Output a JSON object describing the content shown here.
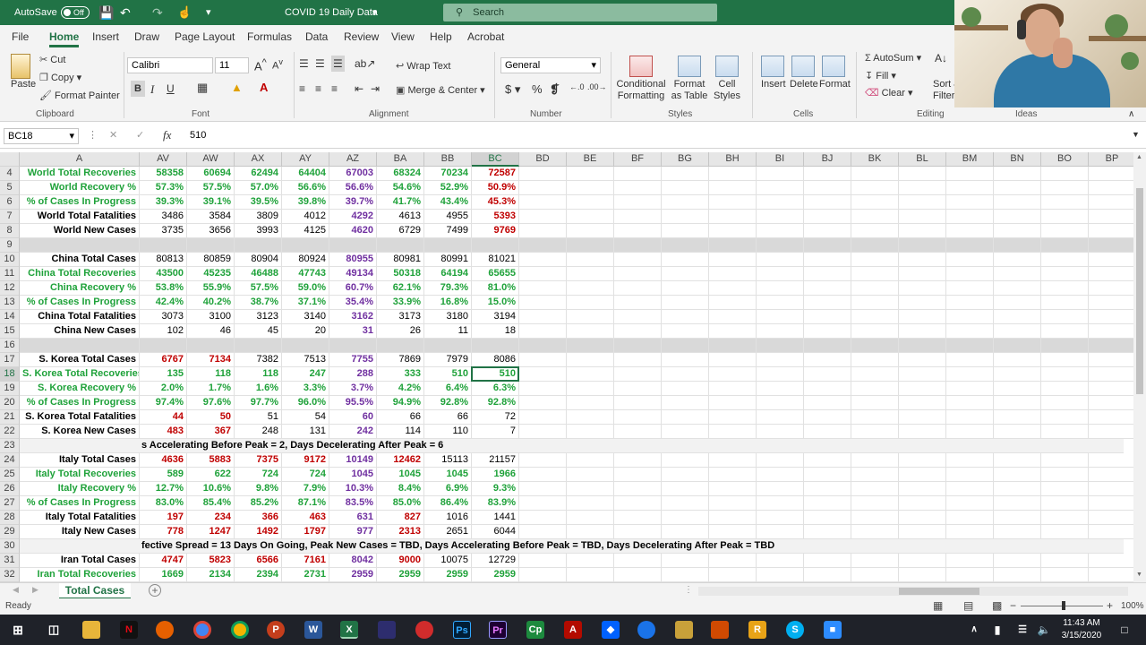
{
  "titlebar": {
    "autosave_label": "AutoSave",
    "autosave_state": "Off",
    "doc_title": "COVID 19 Daily Data",
    "search_placeholder": "Search"
  },
  "menu": {
    "tabs": [
      "File",
      "Home",
      "Insert",
      "Draw",
      "Page Layout",
      "Formulas",
      "Data",
      "Review",
      "View",
      "Help",
      "Acrobat"
    ]
  },
  "ribbon": {
    "clipboard": {
      "paste": "Paste",
      "cut": "Cut",
      "copy": "Copy",
      "format_painter": "Format Painter",
      "label": "Clipboard"
    },
    "font": {
      "name": "Calibri",
      "size": "11",
      "label": "Font"
    },
    "alignment": {
      "wrap": "Wrap Text",
      "merge": "Merge & Center",
      "label": "Alignment"
    },
    "number": {
      "format": "General",
      "label": "Number"
    },
    "styles": {
      "conditional": "Conditional Formatting",
      "format_table": "Format as Table",
      "cell_styles": "Cell Styles",
      "label": "Styles"
    },
    "cells": {
      "insert": "Insert",
      "delete": "Delete",
      "format": "Format",
      "label": "Cells"
    },
    "editing": {
      "autosum": "AutoSum",
      "fill": "Fill",
      "clear": "Clear",
      "sort": "Sort &",
      "filter": "Filter",
      "label": "Editing"
    },
    "ideas": {
      "label": "Ideas"
    }
  },
  "formula_bar": {
    "name_box": "BC18",
    "content": "510"
  },
  "colors": {
    "green": "#1fa23a",
    "purple": "#7030a0",
    "red": "#c00000",
    "dark": "#000000",
    "accent": "#217346"
  },
  "columns": [
    "A",
    "AV",
    "AW",
    "AX",
    "AY",
    "AZ",
    "BA",
    "BB",
    "BC",
    "BD",
    "BE",
    "BF",
    "BG",
    "BH",
    "BI",
    "BJ",
    "BK",
    "BL",
    "BM",
    "BN",
    "BO",
    "BP"
  ],
  "rows": [
    {
      "n": "4",
      "label": "World Total Recoveries",
      "lc": "green",
      "vals": [
        "58358",
        "60694",
        "62494",
        "64404",
        "67003",
        "68324",
        "70234",
        "72587"
      ],
      "vc": [
        "green",
        "green",
        "green",
        "green",
        "purple",
        "green",
        "green",
        "red"
      ]
    },
    {
      "n": "5",
      "label": "World Recovery %",
      "lc": "green",
      "vals": [
        "57.3%",
        "57.5%",
        "57.0%",
        "56.6%",
        "56.6%",
        "54.6%",
        "52.9%",
        "50.9%"
      ],
      "vc": [
        "green",
        "green",
        "green",
        "green",
        "purple",
        "green",
        "green",
        "red"
      ]
    },
    {
      "n": "6",
      "label": "% of Cases In Progress",
      "lc": "green",
      "vals": [
        "39.3%",
        "39.1%",
        "39.5%",
        "39.8%",
        "39.7%",
        "41.7%",
        "43.4%",
        "45.3%"
      ],
      "vc": [
        "green",
        "green",
        "green",
        "green",
        "purple",
        "green",
        "green",
        "red"
      ]
    },
    {
      "n": "7",
      "label": "World Total Fatalities",
      "lc": "dark",
      "vals": [
        "3486",
        "3584",
        "3809",
        "4012",
        "4292",
        "4613",
        "4955",
        "5393"
      ],
      "vc": [
        "dark",
        "dark",
        "dark",
        "dark",
        "purple",
        "dark",
        "dark",
        "red"
      ]
    },
    {
      "n": "8",
      "label": "World New Cases",
      "lc": "dark",
      "vals": [
        "3735",
        "3656",
        "3993",
        "4125",
        "4620",
        "6729",
        "7499",
        "9769"
      ],
      "vc": [
        "dark",
        "dark",
        "dark",
        "dark",
        "purple",
        "dark",
        "dark",
        "red"
      ]
    },
    {
      "n": "9",
      "sep": true
    },
    {
      "n": "10",
      "label": "China Total Cases",
      "lc": "dark",
      "vals": [
        "80813",
        "80859",
        "80904",
        "80924",
        "80955",
        "80981",
        "80991",
        "81021"
      ],
      "vc": [
        "dark",
        "dark",
        "dark",
        "dark",
        "purple",
        "dark",
        "dark",
        "dark"
      ]
    },
    {
      "n": "11",
      "label": "China Total Recoveries",
      "lc": "green",
      "vals": [
        "43500",
        "45235",
        "46488",
        "47743",
        "49134",
        "50318",
        "64194",
        "65655"
      ],
      "vc": [
        "green",
        "green",
        "green",
        "green",
        "purple",
        "green",
        "green",
        "green"
      ]
    },
    {
      "n": "12",
      "label": "China Recovery %",
      "lc": "green",
      "vals": [
        "53.8%",
        "55.9%",
        "57.5%",
        "59.0%",
        "60.7%",
        "62.1%",
        "79.3%",
        "81.0%"
      ],
      "vc": [
        "green",
        "green",
        "green",
        "green",
        "purple",
        "green",
        "green",
        "green"
      ]
    },
    {
      "n": "13",
      "label": "% of Cases In Progress",
      "lc": "green",
      "vals": [
        "42.4%",
        "40.2%",
        "38.7%",
        "37.1%",
        "35.4%",
        "33.9%",
        "16.8%",
        "15.0%"
      ],
      "vc": [
        "green",
        "green",
        "green",
        "green",
        "purple",
        "green",
        "green",
        "green"
      ]
    },
    {
      "n": "14",
      "label": "China Total Fatalities",
      "lc": "dark",
      "vals": [
        "3073",
        "3100",
        "3123",
        "3140",
        "3162",
        "3173",
        "3180",
        "3194"
      ],
      "vc": [
        "dark",
        "dark",
        "dark",
        "dark",
        "purple",
        "dark",
        "dark",
        "dark"
      ]
    },
    {
      "n": "15",
      "label": "China New Cases",
      "lc": "dark",
      "vals": [
        "102",
        "46",
        "45",
        "20",
        "31",
        "26",
        "11",
        "18"
      ],
      "vc": [
        "dark",
        "dark",
        "dark",
        "dark",
        "purple",
        "dark",
        "dark",
        "dark"
      ]
    },
    {
      "n": "16",
      "sep": true
    },
    {
      "n": "17",
      "label": "S. Korea Total Cases",
      "lc": "dark",
      "vals": [
        "6767",
        "7134",
        "7382",
        "7513",
        "7755",
        "7869",
        "7979",
        "8086"
      ],
      "vc": [
        "red",
        "red",
        "dark",
        "dark",
        "purple",
        "dark",
        "dark",
        "dark"
      ]
    },
    {
      "n": "18",
      "label": "S. Korea Total Recoveries",
      "lc": "green",
      "vals": [
        "135",
        "118",
        "118",
        "247",
        "288",
        "333",
        "510",
        "510"
      ],
      "vc": [
        "green",
        "green",
        "green",
        "green",
        "purple",
        "green",
        "green",
        "green"
      ]
    },
    {
      "n": "19",
      "label": "S. Korea Recovery %",
      "lc": "green",
      "vals": [
        "2.0%",
        "1.7%",
        "1.6%",
        "3.3%",
        "3.7%",
        "4.2%",
        "6.4%",
        "6.3%"
      ],
      "vc": [
        "green",
        "green",
        "green",
        "green",
        "purple",
        "green",
        "green",
        "green"
      ]
    },
    {
      "n": "20",
      "label": "% of Cases In Progress",
      "lc": "green",
      "vals": [
        "97.4%",
        "97.6%",
        "97.7%",
        "96.0%",
        "95.5%",
        "94.9%",
        "92.8%",
        "92.8%"
      ],
      "vc": [
        "green",
        "green",
        "green",
        "green",
        "purple",
        "green",
        "green",
        "green"
      ]
    },
    {
      "n": "21",
      "label": "S. Korea Total Fatalities",
      "lc": "dark",
      "vals": [
        "44",
        "50",
        "51",
        "54",
        "60",
        "66",
        "66",
        "72"
      ],
      "vc": [
        "red",
        "red",
        "dark",
        "dark",
        "purple",
        "dark",
        "dark",
        "dark"
      ]
    },
    {
      "n": "22",
      "label": "S. Korea New Cases",
      "lc": "dark",
      "vals": [
        "483",
        "367",
        "248",
        "131",
        "242",
        "114",
        "110",
        "7"
      ],
      "vc": [
        "red",
        "red",
        "dark",
        "dark",
        "purple",
        "dark",
        "dark",
        "dark"
      ]
    },
    {
      "n": "23",
      "note": "s Accelerating Before Peak = 2, Days Decelerating After Peak = 6"
    },
    {
      "n": "24",
      "label": "Italy Total Cases",
      "lc": "dark",
      "vals": [
        "4636",
        "5883",
        "7375",
        "9172",
        "10149",
        "12462",
        "15113",
        "21157"
      ],
      "vc": [
        "red",
        "red",
        "red",
        "red",
        "purple",
        "red",
        "dark",
        "dark"
      ]
    },
    {
      "n": "25",
      "label": "Italy Total Recoveries",
      "lc": "green",
      "vals": [
        "589",
        "622",
        "724",
        "724",
        "1045",
        "1045",
        "1045",
        "1966"
      ],
      "vc": [
        "green",
        "green",
        "green",
        "green",
        "purple",
        "green",
        "green",
        "green"
      ]
    },
    {
      "n": "26",
      "label": "Italy Recovery %",
      "lc": "green",
      "vals": [
        "12.7%",
        "10.6%",
        "9.8%",
        "7.9%",
        "10.3%",
        "8.4%",
        "6.9%",
        "9.3%"
      ],
      "vc": [
        "green",
        "green",
        "green",
        "green",
        "purple",
        "green",
        "green",
        "green"
      ]
    },
    {
      "n": "27",
      "label": "% of Cases In Progress",
      "lc": "green",
      "vals": [
        "83.0%",
        "85.4%",
        "85.2%",
        "87.1%",
        "83.5%",
        "85.0%",
        "86.4%",
        "83.9%"
      ],
      "vc": [
        "green",
        "green",
        "green",
        "green",
        "purple",
        "green",
        "green",
        "green"
      ]
    },
    {
      "n": "28",
      "label": "Italy Total Fatalities",
      "lc": "dark",
      "vals": [
        "197",
        "234",
        "366",
        "463",
        "631",
        "827",
        "1016",
        "1441"
      ],
      "vc": [
        "red",
        "red",
        "red",
        "red",
        "purple",
        "red",
        "dark",
        "dark"
      ]
    },
    {
      "n": "29",
      "label": "Italy New Cases",
      "lc": "dark",
      "vals": [
        "778",
        "1247",
        "1492",
        "1797",
        "977",
        "2313",
        "2651",
        "6044"
      ],
      "vc": [
        "red",
        "red",
        "red",
        "red",
        "purple",
        "red",
        "dark",
        "dark"
      ]
    },
    {
      "n": "30",
      "note": "fective Spread = 13 Days On Going, Peak New Cases = TBD, Days Accelerating Before Peak = TBD, Days Decelerating After Peak = TBD"
    },
    {
      "n": "31",
      "label": "Iran Total Cases",
      "lc": "dark",
      "vals": [
        "4747",
        "5823",
        "6566",
        "7161",
        "8042",
        "9000",
        "10075",
        "12729"
      ],
      "vc": [
        "red",
        "red",
        "red",
        "red",
        "purple",
        "red",
        "dark",
        "dark"
      ]
    },
    {
      "n": "32",
      "label": "Iran Total Recoveries",
      "lc": "green",
      "vals": [
        "1669",
        "2134",
        "2394",
        "2731",
        "2959",
        "2959",
        "2959",
        "2959"
      ],
      "vc": [
        "green",
        "green",
        "green",
        "green",
        "purple",
        "green",
        "green",
        "green"
      ]
    }
  ],
  "sheet_tab": "Total Cases",
  "status": {
    "ready": "Ready",
    "zoom": "100%"
  },
  "clock": {
    "time": "11:43 AM",
    "date": "3/15/2020"
  }
}
